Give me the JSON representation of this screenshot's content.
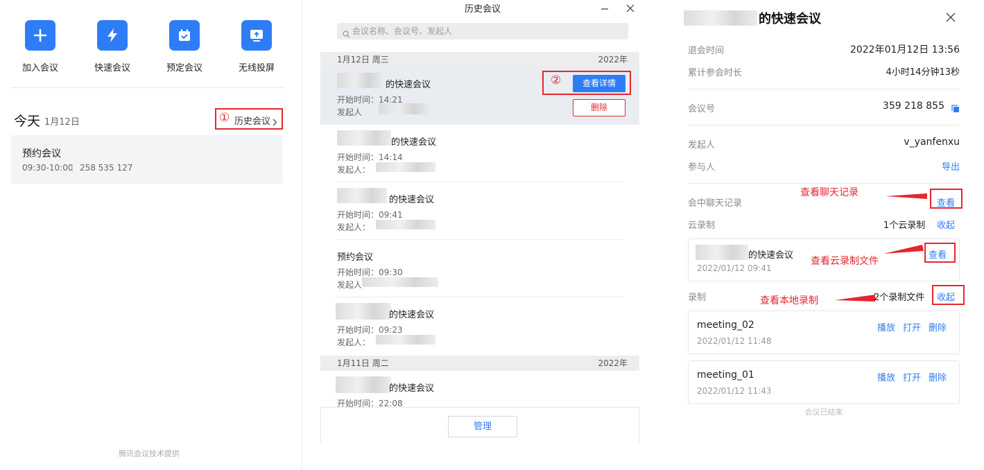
{
  "left": {
    "quick_actions": [
      {
        "label": "加入会议",
        "icon": "plus-icon"
      },
      {
        "label": "快速会议",
        "icon": "lightning-icon"
      },
      {
        "label": "预定会议",
        "icon": "calendar-check-icon"
      },
      {
        "label": "无线投屏",
        "icon": "screen-cast-icon"
      }
    ],
    "today_label": "今天",
    "today_date": "1月12日",
    "history_marker": "①",
    "history_link": "历史会议",
    "scheduled": {
      "title": "预约会议",
      "time": "09:30-10:00",
      "id": "258 535 127"
    },
    "footer": "腾讯会议技术提供"
  },
  "history": {
    "title": "历史会议",
    "search_placeholder": "会议名称、会议号、发起人",
    "groups": [
      {
        "date": "1月12日 周三",
        "year": "2022年"
      },
      {
        "date": "1月11日 周二",
        "year": "2022年"
      }
    ],
    "items": [
      {
        "title": "的快速会议",
        "start": "开始时间：14:21",
        "organizer": "发起人"
      },
      {
        "title": "的快速会议",
        "start": "开始时间：14:14",
        "organizer": "发起人："
      },
      {
        "title": "的快速会议",
        "start": "开始时间：09:41",
        "organizer": "发起人："
      },
      {
        "title": "预约会议",
        "start": "开始时间：09:30",
        "organizer": "发起人"
      },
      {
        "title": "的快速会议",
        "start": "开始时间：09:23",
        "organizer": "发起人："
      },
      {
        "title": "的快速会议",
        "start": "开始时间：22:08",
        "organizer": ""
      }
    ],
    "detail_marker": "②",
    "detail_button": "查看详情",
    "delete_button": "删除",
    "manage_button": "管理"
  },
  "detail": {
    "title": "的快速会议",
    "fields": [
      {
        "label": "退会时间",
        "value": "2022年01月12日 13:56"
      },
      {
        "label": "累计参会时长",
        "value": "4小时14分钟13秒"
      },
      {
        "label": "会议号",
        "value": "359 218 855"
      },
      {
        "label": "发起人",
        "value": "v_yanfenxu"
      },
      {
        "label": "参与人",
        "value": "导出"
      },
      {
        "label": "会中聊天记录",
        "value": "查看"
      },
      {
        "label": "云录制",
        "value": "1个云录制",
        "action": "收起"
      },
      {
        "label": "录制",
        "value": "2个录制文件",
        "action": "收起"
      }
    ],
    "cloud_recording": {
      "title": "的快速会议",
      "time": "2022/01/12 09:41",
      "action": "查看"
    },
    "local_recordings": [
      {
        "name": "meeting_02",
        "time": "2022/01/12 11:48"
      },
      {
        "name": "meeting_01",
        "time": "2022/01/12 11:43"
      }
    ],
    "rec_actions": {
      "play": "播放",
      "open": "打开",
      "delete": "删除"
    },
    "ended": "会议已结束"
  },
  "annotations": {
    "chat": "查看聊天记录",
    "cloud": "查看云录制文件",
    "local": "查看本地录制"
  },
  "colors": {
    "accent": "#2e7df6",
    "annotation": "#e5262f",
    "selected_row": "#e9ecf1"
  }
}
